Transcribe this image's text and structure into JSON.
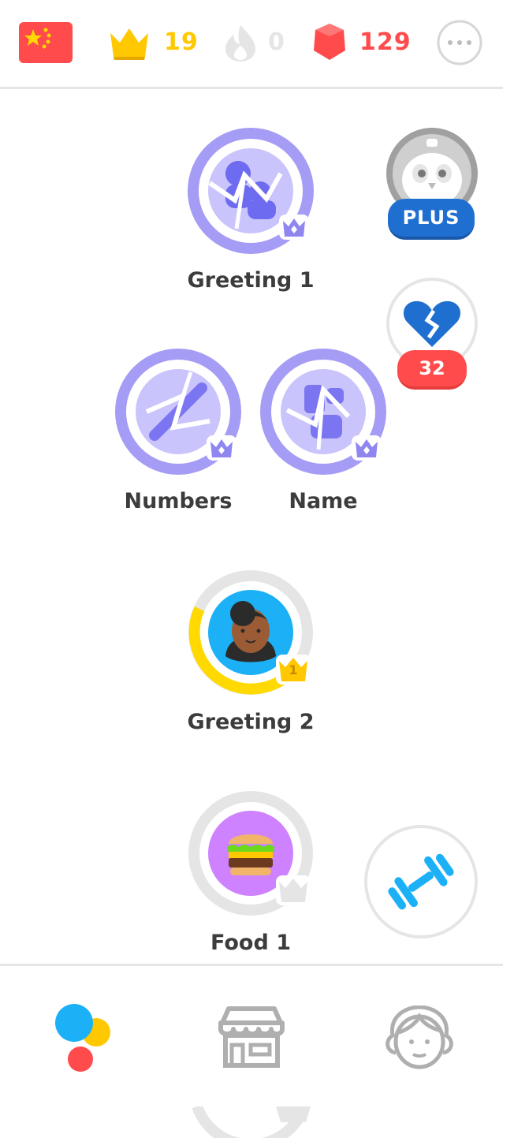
{
  "header": {
    "course_flag": "china-flag",
    "crowns": "19",
    "streak": "0",
    "gems": "129",
    "more_icon": "more-horizontal-icon"
  },
  "side": {
    "plus_badge": "PLUS",
    "hearts": "32",
    "practice_icon": "dumbbell-icon"
  },
  "skills": [
    {
      "label": "Greeting 1",
      "level": "",
      "state": "cracked"
    },
    {
      "label": "Numbers",
      "level": "",
      "state": "cracked"
    },
    {
      "label": "Name",
      "level": "",
      "state": "cracked"
    },
    {
      "label": "Greeting 2",
      "level": "1",
      "state": "in-progress"
    },
    {
      "label": "Food 1",
      "level": "",
      "state": "unlocked"
    }
  ],
  "nav": {
    "items": [
      "learn-icon",
      "shop-icon",
      "profile-icon"
    ]
  },
  "colors": {
    "gold": "#ffc800",
    "gem_red": "#ff4b4b",
    "cracked_purple": "#a59cf5",
    "plus_blue": "#1f6fd1",
    "practice_blue": "#1cb0f6"
  }
}
